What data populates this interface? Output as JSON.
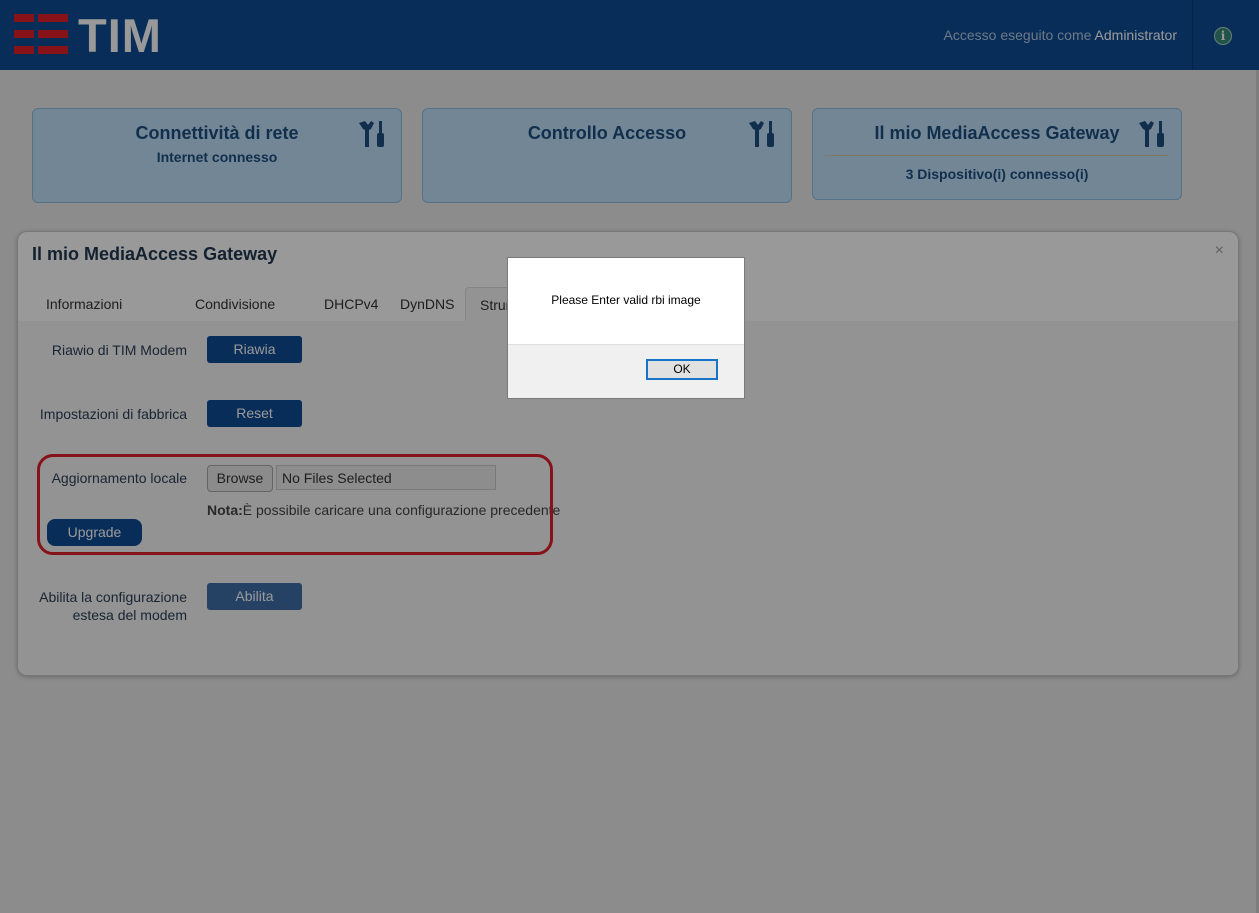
{
  "header": {
    "logo_text": "TIM",
    "login_prefix": "Accesso eseguito come",
    "user": "Administrator",
    "brand_color": "#0e4c94",
    "logo_accent": "#e2202a"
  },
  "cards": [
    {
      "title": "Connettività di rete",
      "subtitle": "Internet connesso"
    },
    {
      "title": "Controllo Accesso",
      "subtitle": ""
    },
    {
      "title": "Il mio MediaAccess Gateway",
      "subtitle": "3 Dispositivo(i) connesso(i)"
    }
  ],
  "panel": {
    "title": "Il mio MediaAccess Gateway",
    "close": "×",
    "tabs": [
      {
        "label": "Informazioni Generali"
      },
      {
        "label": "Condivisione LAN"
      },
      {
        "label": "DHCPv4"
      },
      {
        "label": "DynDNS"
      },
      {
        "label": "Strun"
      }
    ],
    "rows": {
      "restart_label": "Riawio di TIM Modem",
      "restart_button": "Riawia",
      "factory_label": "Impostazioni di fabbrica",
      "reset_button": "Reset",
      "upgrade_label": "Aggiornamento locale",
      "browse_button": "Browse",
      "file_value": "No Files Selected",
      "note_bold": "Nota:",
      "note_text": "È possibile caricare una configurazione precedente",
      "upgrade_button": "Upgrade",
      "extended_label_1": "Abilita la configurazione",
      "extended_label_2": "estesa del modem",
      "enable_button": "Abilita"
    }
  },
  "dialog": {
    "message": "Please Enter valid rbi image",
    "ok_label": "OK"
  }
}
